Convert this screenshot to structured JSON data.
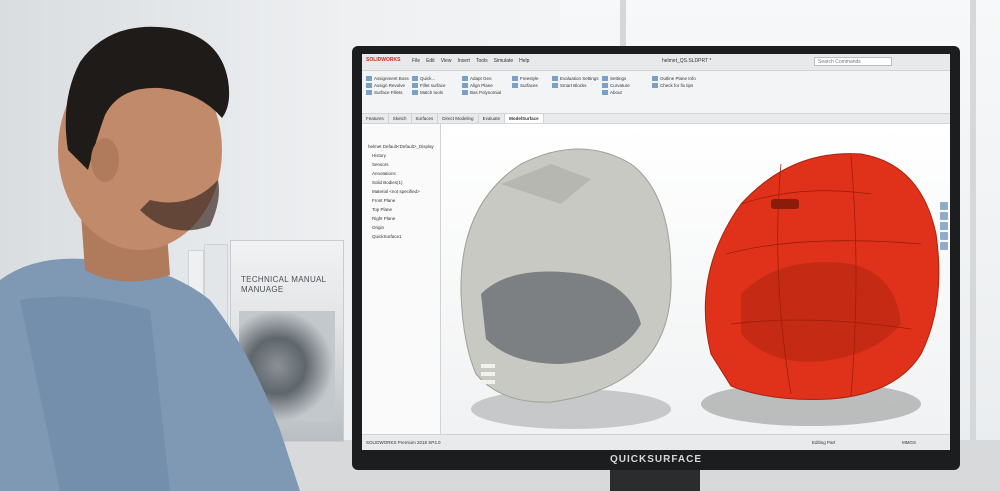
{
  "monitor": {
    "brand": "QUICKSURFACE"
  },
  "book": {
    "title_line1": "TECHNICAL MANUAL",
    "title_line2": "MANUAGE"
  },
  "app": {
    "logo": "SOLIDWORKS",
    "menu": [
      "File",
      "Edit",
      "View",
      "Insert",
      "Tools",
      "Simulate",
      "Help"
    ],
    "doc_title": "helmet_QS.SLDPRT *",
    "search_placeholder": "Search Commands",
    "ribbon": {
      "group1": [
        "Assignment Boss",
        "Assign Revolve",
        "Surface Fillets"
      ],
      "group2": [
        "Quick...",
        "Fillet surface",
        "Match tools"
      ],
      "group3": [
        "Adapt Geo",
        "Align Plane",
        "Bas Polynomial"
      ],
      "group4": [
        "Freestyle",
        "Surfaces"
      ],
      "group5": [
        "Evaluation Settings",
        "Smart Blocks"
      ],
      "group6": [
        "Settings",
        "Curvature",
        "About"
      ],
      "group7": [
        "Outline Plane Info",
        "Check for fix tips"
      ]
    },
    "tabs": [
      "Features",
      "Sketch",
      "Surfaces",
      "Direct Modeling",
      "Evaluate",
      "ModelSurface"
    ],
    "active_tab": "ModelSurface",
    "tree": [
      "helmet Default<Default>_Display",
      "History",
      "Sensors",
      "Annotations",
      "Solid Bodies(1)",
      "Material <not specified>",
      "Front Plane",
      "Top Plane",
      "Right Plane",
      "Origin",
      "QuickSurface1"
    ],
    "status_left": "SOLIDWORKS Premium 2018 SP4.0",
    "status_mid": "Editing Part",
    "status_right": "MMGS"
  }
}
